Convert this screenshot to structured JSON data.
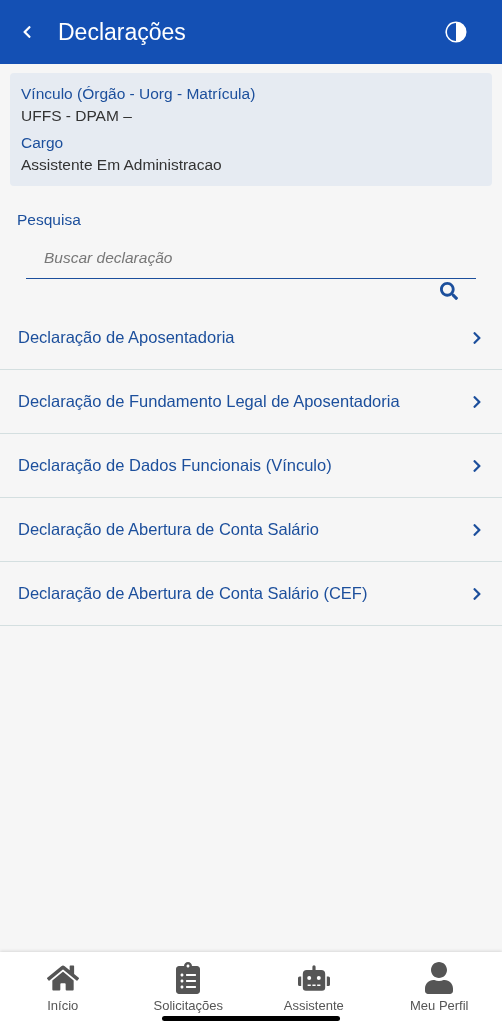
{
  "header": {
    "title": "Declarações"
  },
  "vinculo": {
    "label": "Vínculo (Órgão - Uorg - Matrícula)",
    "value": "UFFS - DPAM –",
    "cargo_label": "Cargo",
    "cargo_value": "Assistente Em Administracao"
  },
  "search": {
    "label": "Pesquisa",
    "placeholder": "Buscar declaração"
  },
  "items": [
    {
      "label": "Declaração de Aposentadoria"
    },
    {
      "label": "Declaração de Fundamento Legal de Aposentadoria"
    },
    {
      "label": "Declaração de Dados Funcionais (Vínculo)"
    },
    {
      "label": "Declaração de Abertura de Conta Salário"
    },
    {
      "label": "Declaração de Abertura de Conta Salário (CEF)"
    }
  ],
  "nav": [
    {
      "label": "Início"
    },
    {
      "label": "Solicitações"
    },
    {
      "label": "Assistente"
    },
    {
      "label": "Meu Perfil"
    }
  ]
}
